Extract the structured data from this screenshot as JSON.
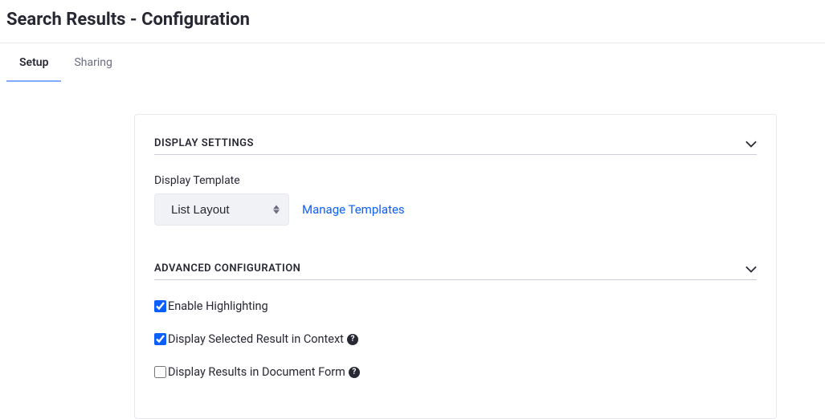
{
  "header": {
    "title": "Search Results - Configuration"
  },
  "tabs": [
    {
      "label": "Setup",
      "active": true
    },
    {
      "label": "Sharing",
      "active": false
    }
  ],
  "sections": {
    "display_settings": {
      "title": "DISPLAY SETTINGS",
      "template_label": "Display Template",
      "template_value": "List Layout",
      "manage_link": "Manage Templates"
    },
    "advanced": {
      "title": "ADVANCED CONFIGURATION",
      "options": [
        {
          "label": "Enable Highlighting",
          "checked": true,
          "help": false
        },
        {
          "label": "Display Selected Result in Context",
          "checked": true,
          "help": true
        },
        {
          "label": "Display Results in Document Form",
          "checked": false,
          "help": true
        }
      ]
    }
  }
}
